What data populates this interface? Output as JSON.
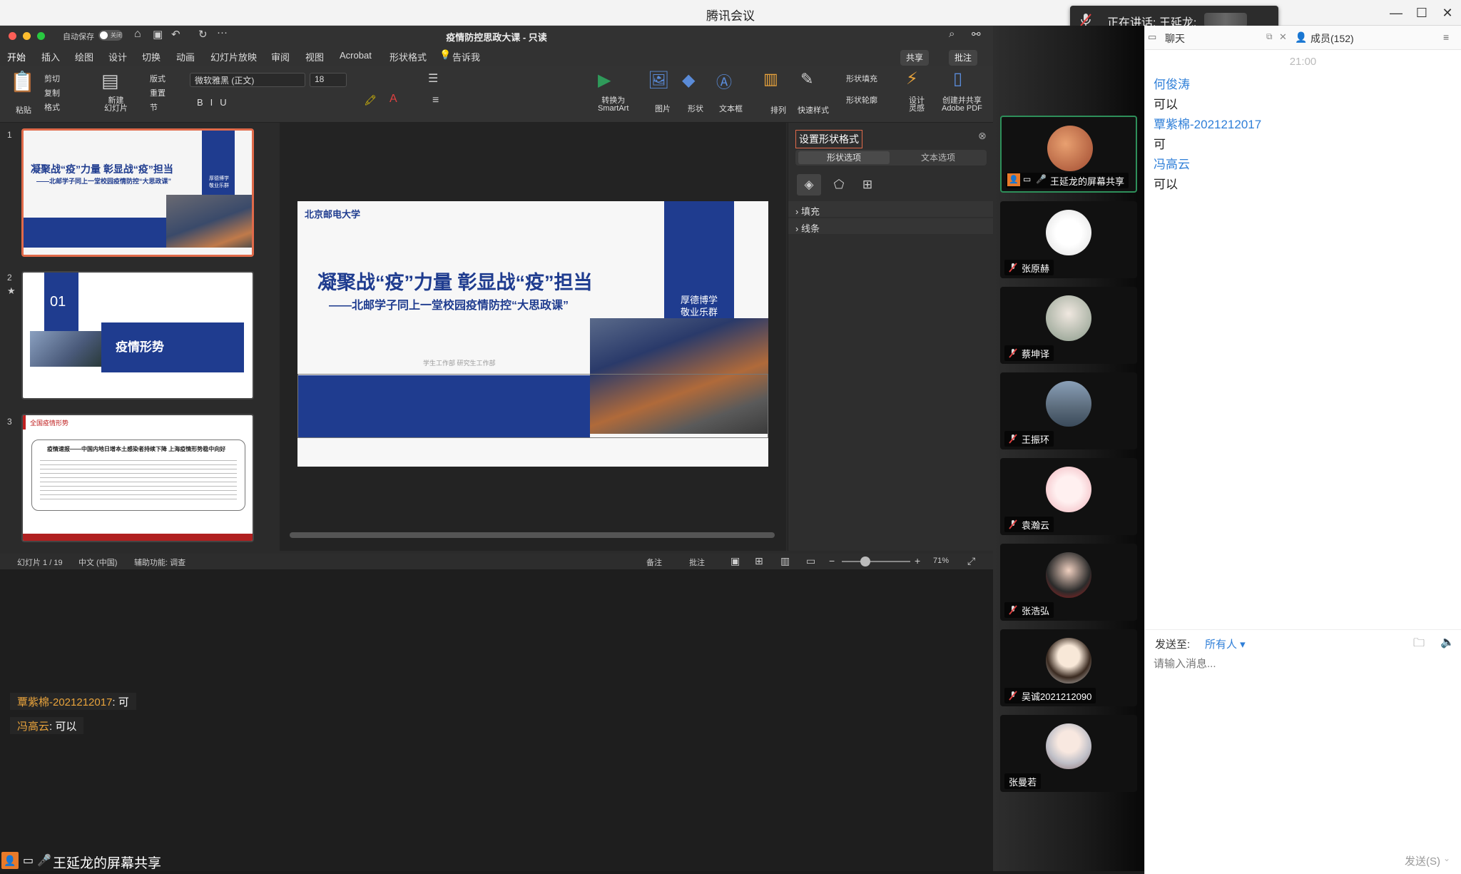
{
  "app": {
    "title": "腾讯会议"
  },
  "speaking": {
    "text": "正在讲话: 王延龙;"
  },
  "ppt": {
    "doc_title": "疫情防控思政大课 - 只读",
    "autosave_label": "自动保存",
    "autosave_state": "关闭",
    "menu": [
      "开始",
      "插入",
      "绘图",
      "设计",
      "切换",
      "动画",
      "幻灯片放映",
      "审阅",
      "视图",
      "Acrobat",
      "形状格式",
      "告诉我"
    ],
    "share_btn": "共享",
    "comment_btn": "批注",
    "ribbon": {
      "paste": "粘贴",
      "cut": "剪切",
      "copy": "复制",
      "format": "格式",
      "new_slide": "新建\n幻灯片",
      "layout": "版式",
      "reset": "重置",
      "section": "节",
      "font_name": "微软雅黑 (正文)",
      "font_size": "18",
      "smartart": "转换为\nSmartArt",
      "picture": "图片",
      "shape": "形状",
      "textbox": "文本框",
      "arrange": "排列",
      "quick_style": "快速样式",
      "shape_fill": "形状填充",
      "shape_outline": "形状轮廓",
      "designer": "设计\n灵感",
      "adobe": "创建并共享\nAdobe PDF"
    },
    "thumbs": [
      {
        "num": "1",
        "title": "凝聚战“疫”力量 彰显战“疫”担当",
        "subtitle": "——北邮学子同上一堂校园疫情防控“大思政课”",
        "side": "厚德博学\n敬业乐群"
      },
      {
        "num": "2",
        "badge": "01",
        "title": "疫情形势"
      },
      {
        "num": "3",
        "title": "全国疫情形势",
        "headline": "疫情速报——中国内地日增本土感染者持续下降 上海疫情形势稳中向好"
      }
    ],
    "slide": {
      "logo": "北京邮电大学",
      "title": "凝聚战“疫”力量  彰显战“疫”担当",
      "subtitle": "——北邮学子同上一堂校园疫情防控“大思政课”",
      "side": "厚德博学\n敬业乐群",
      "footer": "学生工作部   研究生工作部"
    },
    "format_pane": {
      "title": "设置形状格式",
      "tab1": "形状选项",
      "tab2": "文本选项",
      "sec1": "填充",
      "sec2": "线条"
    },
    "status": {
      "slide_count": "幻灯片 1 / 19",
      "lang": "中文 (中国)",
      "accessibility": "辅助功能: 调查",
      "notes": "备注",
      "comments": "批注",
      "zoom": "71%"
    }
  },
  "overlays": [
    {
      "name": "覃紫棉-2021212017",
      "text": "可"
    },
    {
      "name": "冯高云",
      "text": "可以"
    }
  ],
  "bottom_share": "王延龙的屏幕共享",
  "videos": [
    {
      "name": "王延龙的屏幕共享",
      "active": true
    },
    {
      "name": "张原赫"
    },
    {
      "name": "蔡坤译"
    },
    {
      "name": "王振环"
    },
    {
      "name": "袁瀚云"
    },
    {
      "name": "张浩弘"
    },
    {
      "name": "吴诚2021212090"
    },
    {
      "name": "张曼若"
    }
  ],
  "chat": {
    "tab_chat": "聊天",
    "tab_members": "成员(152)",
    "time": "21:00",
    "messages": [
      {
        "name": "何俊涛",
        "text": "可以"
      },
      {
        "name": "覃紫棉-2021212017",
        "text": "可"
      },
      {
        "name": "冯高云",
        "text": "可以"
      }
    ],
    "send_to_label": "发送至:",
    "send_to_value": "所有人",
    "input_placeholder": "请输入消息...",
    "send_btn": "发送(S)"
  },
  "colors": {
    "ppt_blue": "#1f3c8f",
    "accent_orange": "#e06a4a",
    "link_blue": "#2f7fd8"
  }
}
